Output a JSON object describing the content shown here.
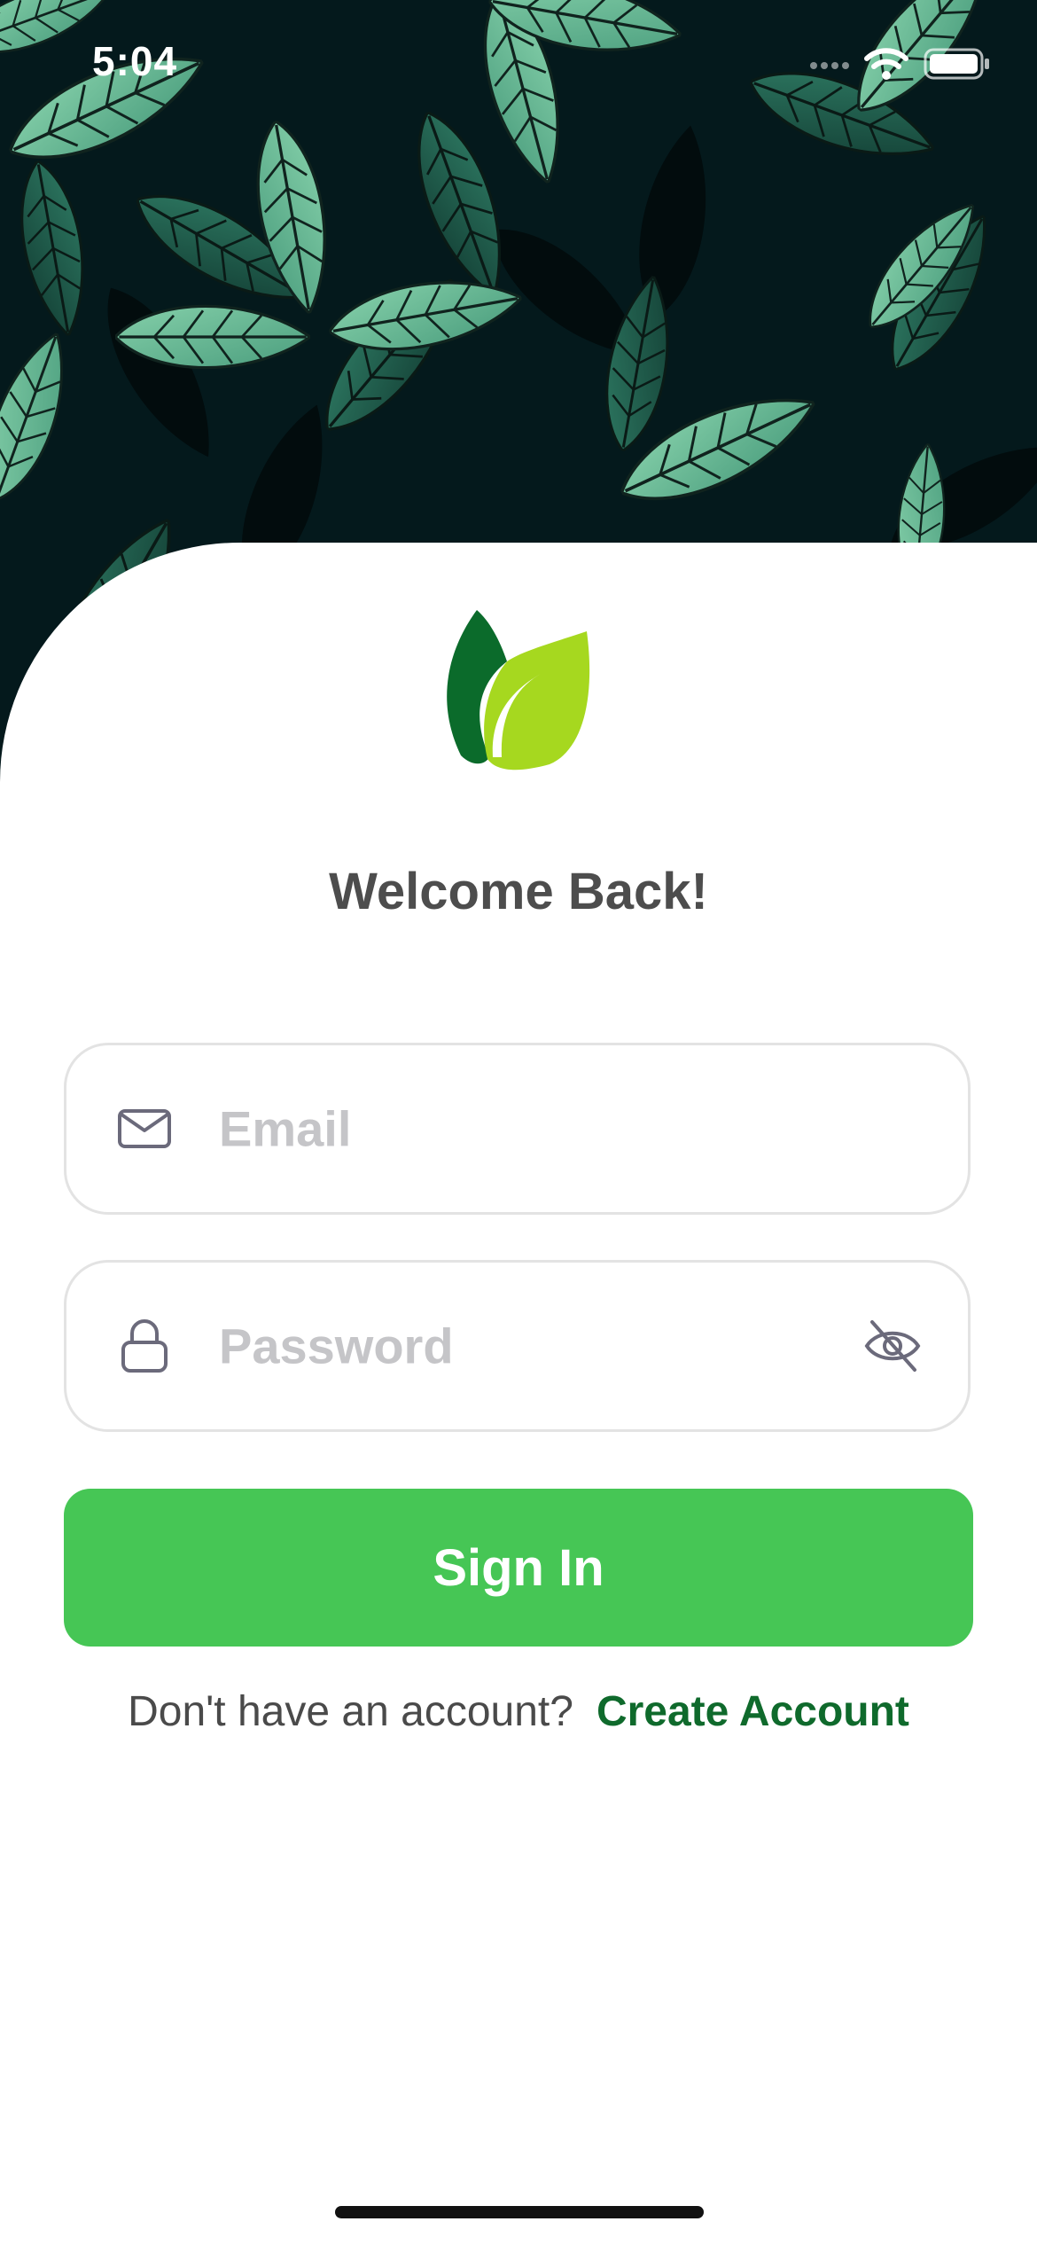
{
  "status_bar": {
    "time": "5:04"
  },
  "auth": {
    "title": "Welcome Back!",
    "email_placeholder": "Email",
    "password_placeholder": "Password",
    "sign_in_label": "Sign In",
    "account_question": "Don't have an account?",
    "create_account_label": "Create Account"
  },
  "icons": {
    "email": "envelope-icon",
    "password": "lock-icon",
    "visibility": "eye-slash-icon",
    "logo": "leaf-logo"
  },
  "colors": {
    "hero_background": "#04191c",
    "leaf_light": "#6fbf96",
    "leaf_dark": "#1f5c4a",
    "primary_button": "#46c655",
    "link": "#0f6a2c",
    "logo_dark_green": "#0b6b2b",
    "logo_lime": "#a6d81f",
    "field_border": "#e3e3e3",
    "placeholder": "#c5c5c8"
  }
}
